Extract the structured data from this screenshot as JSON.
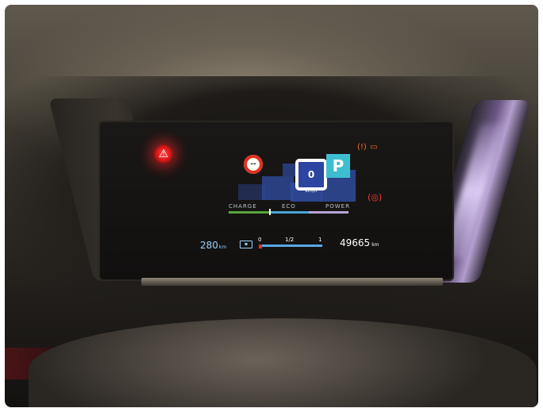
{
  "scene": "Car instrument cluster photo",
  "cluster": {
    "speed": "0",
    "speed_unit": "km/h",
    "gear": "P",
    "speed_limit_sign": "--",
    "seatbelt_icon": "seatbelt-warning-icon",
    "modes": [
      "CHARGE",
      "ECO",
      "POWER"
    ],
    "range_value": "280",
    "range_unit": "km",
    "battery_gauge_ticks": [
      "0",
      "1/2",
      "1"
    ],
    "odometer_value": "49665",
    "odometer_unit": "km",
    "colors": {
      "charge": "#5aa63a",
      "eco": "#4aa3d8",
      "power": "#b9a3d6",
      "gear_bg": "#3dbed0",
      "warning_red": "#e01818",
      "warning_orange": "#ff6a2a"
    }
  }
}
